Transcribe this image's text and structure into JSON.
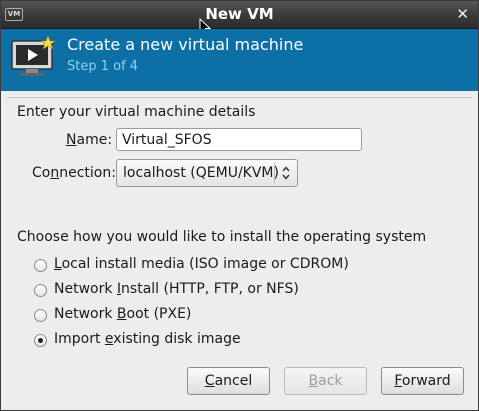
{
  "window": {
    "title": "New VM"
  },
  "banner": {
    "title": "Create a new virtual machine",
    "step": "Step 1 of 4"
  },
  "details": {
    "heading": "Enter your virtual machine details",
    "name_label": "Name:",
    "name_value": "Virtual_SFOS",
    "connection_label": "Connection:",
    "connection_value": "localhost (QEMU/KVM)"
  },
  "install": {
    "heading": "Choose how you would like to install the operating system",
    "options": [
      {
        "label": "Local install media (ISO image or CDROM)",
        "selected": false
      },
      {
        "label": "Network Install (HTTP, FTP, or NFS)",
        "selected": false
      },
      {
        "label": "Network Boot (PXE)",
        "selected": false
      },
      {
        "label": "Import existing disk image",
        "selected": true
      }
    ]
  },
  "buttons": {
    "cancel": "Cancel",
    "back": "Back",
    "forward": "Forward"
  }
}
